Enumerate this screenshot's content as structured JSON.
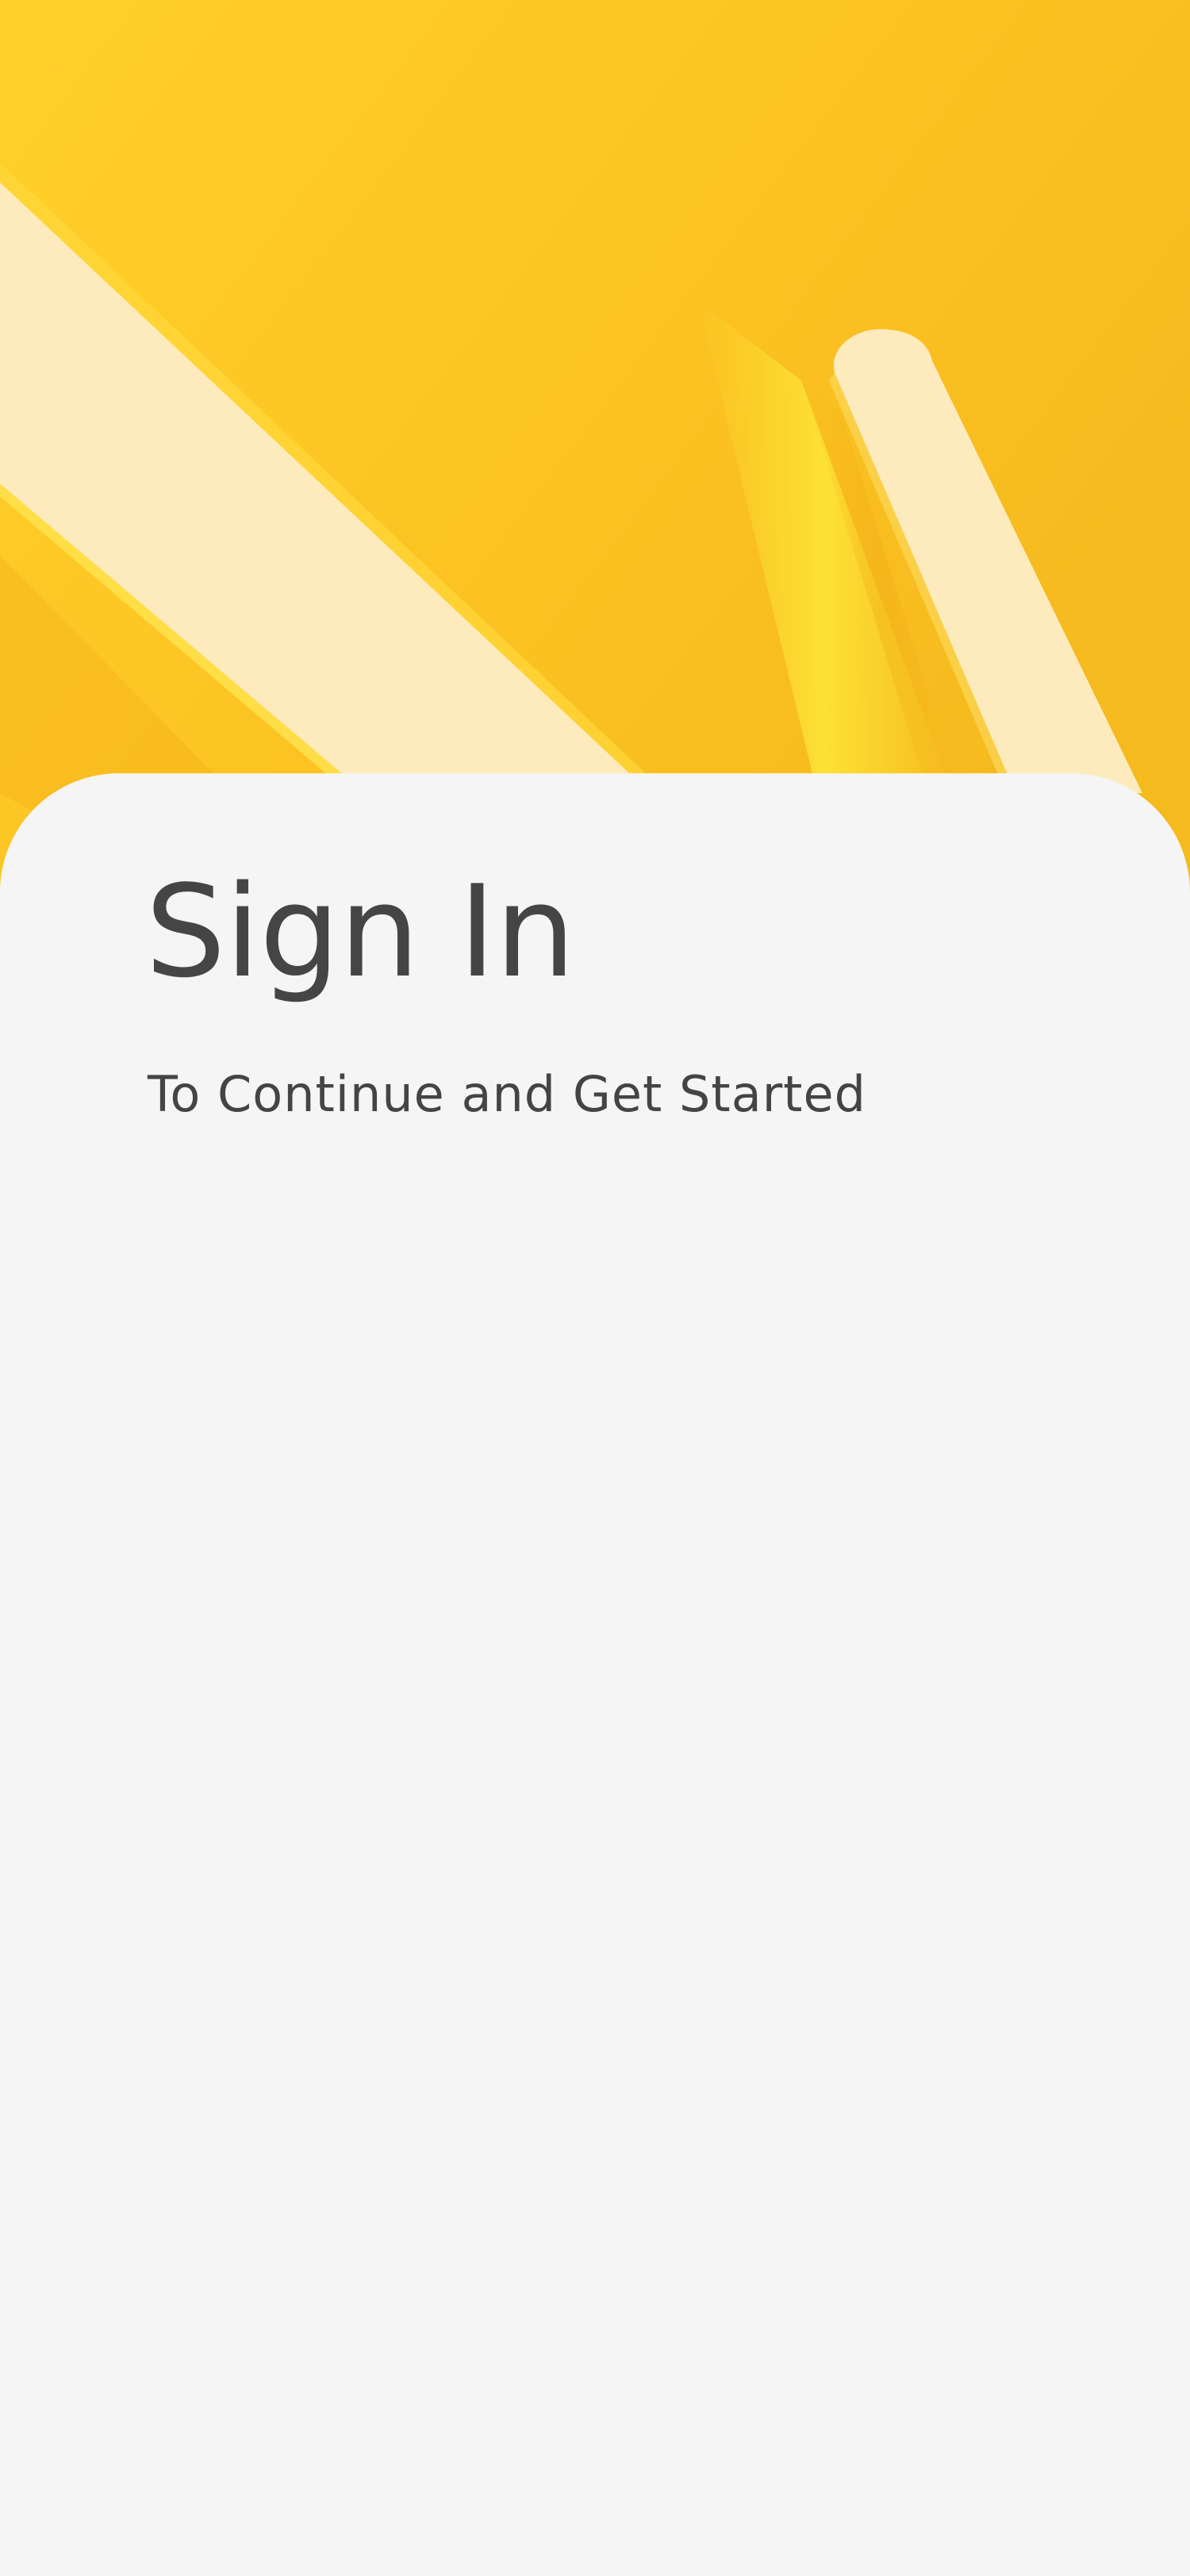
{
  "screen": {
    "title": "Sign In",
    "subtitle": "To Continue and Get Started"
  },
  "hero": {
    "image": "yellow-abstract-background"
  },
  "colors": {
    "hero_yellow": "#fbbf1e",
    "hero_highlight": "#fde83a",
    "stripe_cream": "#fdebbd",
    "card_background": "#f5f5f5",
    "text_dark": "#454545"
  }
}
